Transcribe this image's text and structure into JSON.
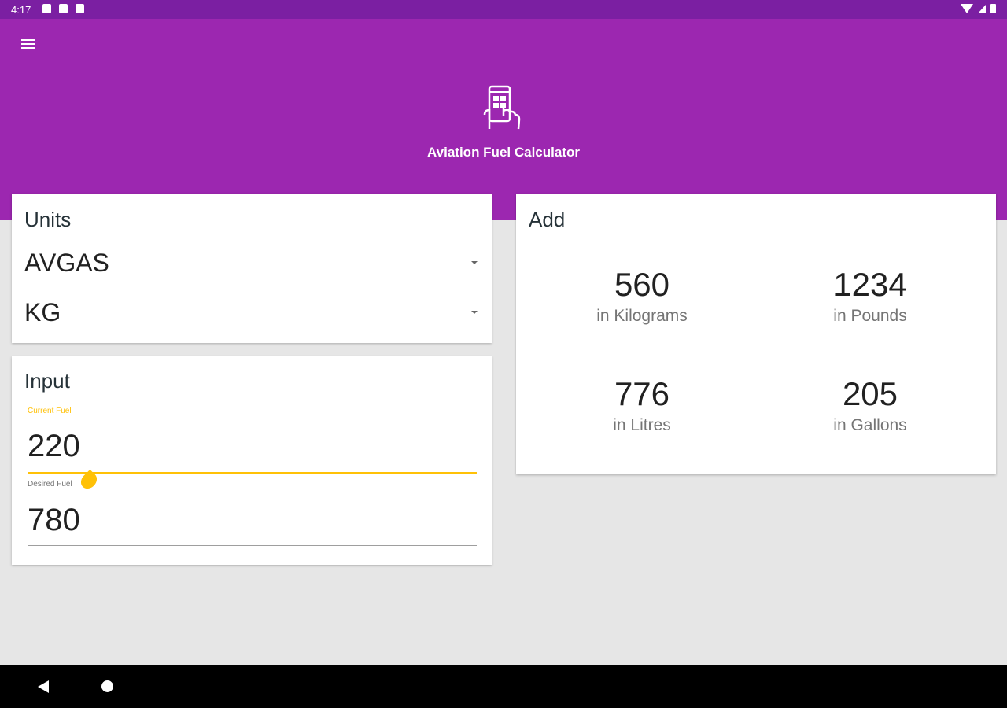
{
  "status_bar": {
    "time": "4:17",
    "left_icons": [
      "settings-icon",
      "notification-icon",
      "sd-card-icon"
    ],
    "right_icons": [
      "wifi-icon",
      "signal-icon",
      "battery-icon"
    ]
  },
  "header": {
    "title": "Aviation Fuel Calculator",
    "logo_icon": "phone-hand-icon",
    "menu_icon": "menu-icon",
    "background_color": "#9c27b0",
    "status_bar_color": "#7b1fa2"
  },
  "units": {
    "title": "Units",
    "fuel_type": "AVGAS",
    "unit": "KG"
  },
  "input": {
    "title": "Input",
    "current_fuel": {
      "label": "Current Fuel",
      "value": "220"
    },
    "desired_fuel": {
      "label": "Desired Fuel",
      "value": "780"
    },
    "accent_color": "#ffc107"
  },
  "add": {
    "title": "Add",
    "results": [
      {
        "value": "560",
        "label": "in Kilograms"
      },
      {
        "value": "1234",
        "label": "in Pounds"
      },
      {
        "value": "776",
        "label": "in Litres"
      },
      {
        "value": "205",
        "label": "in Gallons"
      }
    ]
  },
  "nav_bar": {
    "icons": [
      "back-icon",
      "home-icon"
    ]
  }
}
